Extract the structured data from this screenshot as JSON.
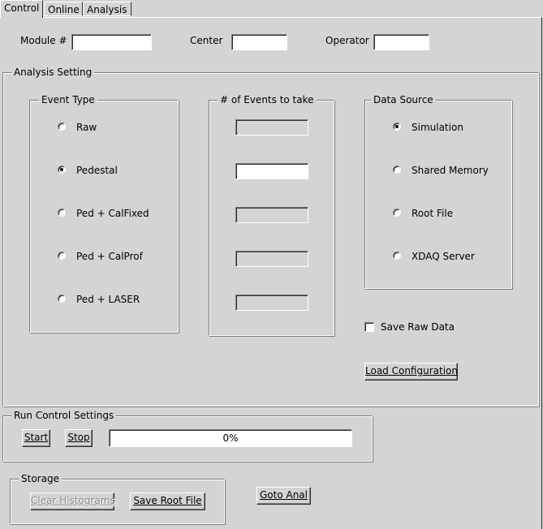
{
  "tabs": [
    {
      "label": "Control",
      "active": true
    },
    {
      "label": "Online",
      "active": false
    },
    {
      "label": "Analysis",
      "active": false
    }
  ],
  "header": {
    "module_label": "Module #",
    "module_value": "",
    "center_label": "Center",
    "center_value": "",
    "operator_label": "Operator",
    "operator_value": ""
  },
  "analysis": {
    "title": "Analysis Setting",
    "event_type": {
      "title": "Event Type",
      "options": [
        "Raw",
        "Pedestal",
        "Ped + CalFixed",
        "Ped + CalProf",
        "Ped + LASER"
      ],
      "selected": "Pedestal"
    },
    "events": {
      "title": "# of Events to take",
      "fields": [
        "",
        "",
        "",
        "",
        ""
      ],
      "enabled": [
        false,
        true,
        false,
        false,
        false
      ]
    },
    "data_source": {
      "title": "Data Source",
      "options": [
        "Simulation",
        "Shared Memory",
        "Root File",
        "XDAQ Server"
      ],
      "selected": "Simulation"
    },
    "save_raw_label": "Save Raw Data",
    "save_raw_checked": false,
    "load_config_label": "Load Configuration"
  },
  "run_control": {
    "title": "Run Control Settings",
    "start_label": "Start",
    "stop_label": "Stop",
    "progress_text": "0%",
    "progress_value": 0
  },
  "storage": {
    "title": "Storage",
    "clear_label": "Clear Histograms",
    "save_root_label": "Save Root File"
  },
  "goto_anal_label": "Goto Anal"
}
